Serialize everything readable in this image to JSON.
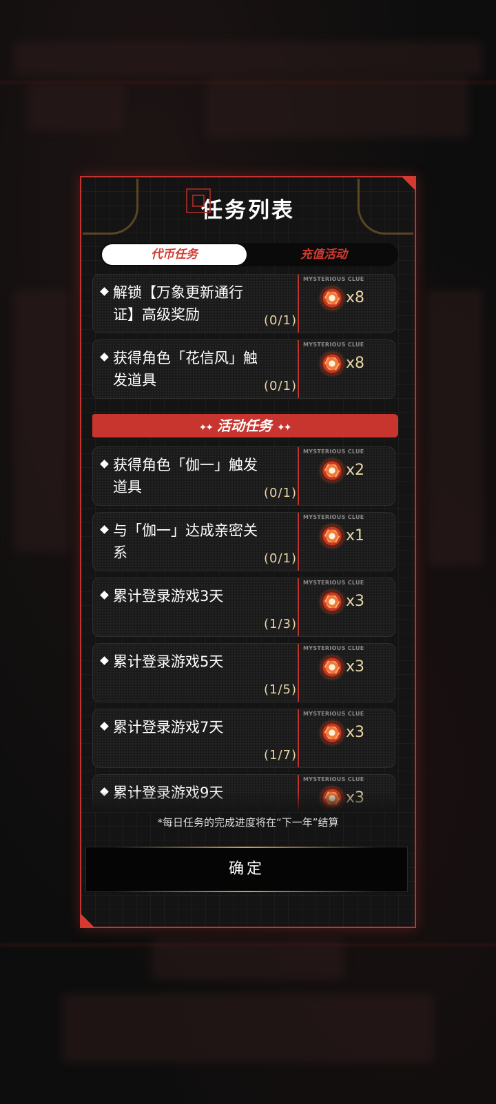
{
  "dialog": {
    "title": "任务列表",
    "tabs": [
      {
        "label": "代币任务",
        "active": true
      },
      {
        "label": "充值活动",
        "active": false
      }
    ],
    "section_label": "活动任务",
    "footnote": "*每日任务的完成进度将在“下一年”结算",
    "confirm_label": "确定"
  },
  "reward_label": "MYSTERIOUS CLUE",
  "tasks_top": [
    {
      "line1": "解锁【万象更新通行",
      "line2": "证】高级奖励",
      "progress": "(0/1)",
      "qty": "x8"
    },
    {
      "line1": "获得角色「花信风」触",
      "line2": "发道具",
      "progress": "(0/1)",
      "qty": "x8"
    }
  ],
  "tasks_activity": [
    {
      "line1": "获得角色「伽一」触发",
      "line2": "道具",
      "progress": "(0/1)",
      "qty": "x2"
    },
    {
      "line1": "与「伽一」达成亲密关",
      "line2": "系",
      "progress": "(0/1)",
      "qty": "x1"
    },
    {
      "line1": "累计登录游戏3天",
      "line2": "",
      "progress": "(1/3)",
      "qty": "x3"
    },
    {
      "line1": "累计登录游戏5天",
      "line2": "",
      "progress": "(1/5)",
      "qty": "x3"
    },
    {
      "line1": "累计登录游戏7天",
      "line2": "",
      "progress": "(1/7)",
      "qty": "x3"
    },
    {
      "line1": "累计登录游戏9天",
      "line2": "",
      "progress": "",
      "qty": "x3"
    }
  ],
  "colors": {
    "accent": "#c8352e",
    "gold": "#e8d7a8",
    "background": "#141414"
  },
  "icons": {
    "reward": "mysterious-clue-icon",
    "bullet": "diamond-bullet-icon"
  }
}
